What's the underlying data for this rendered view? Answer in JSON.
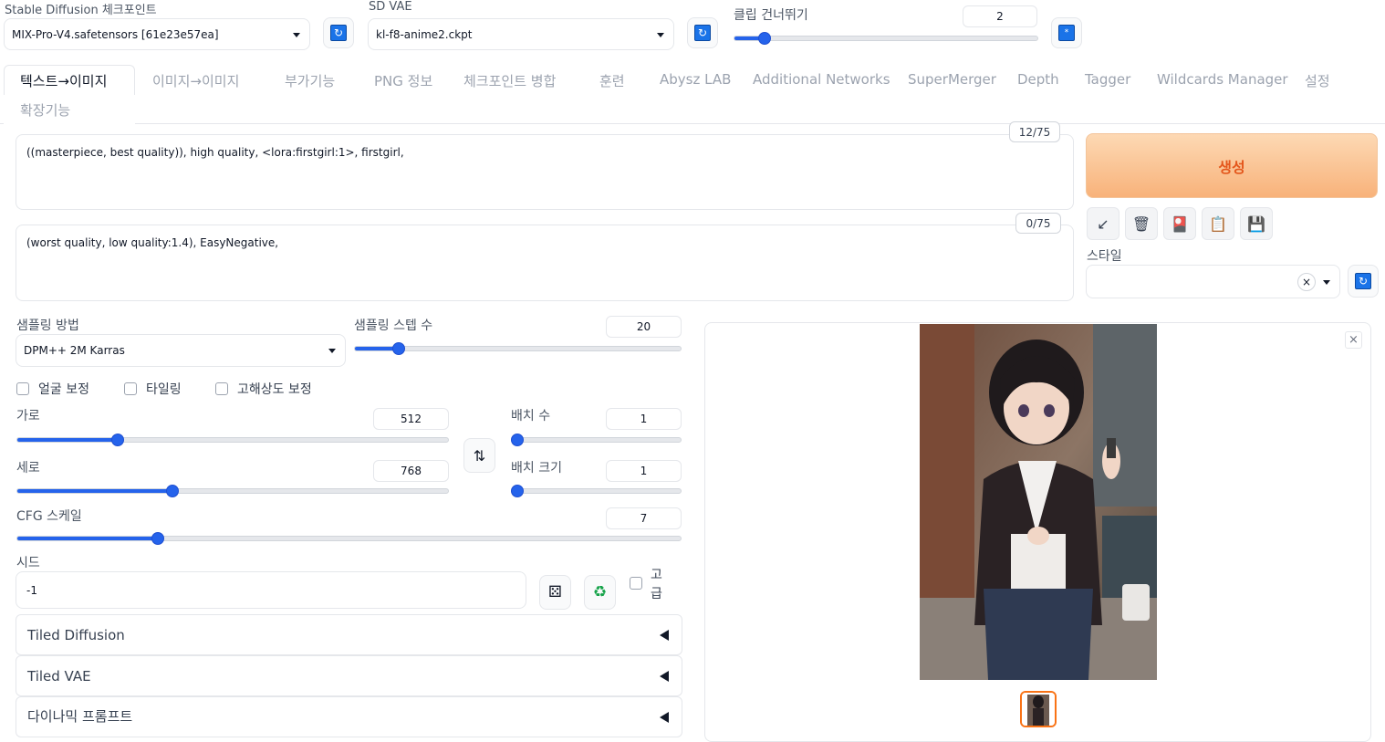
{
  "top": {
    "checkpoint": {
      "label": "Stable Diffusion 체크포인트",
      "value": "MIX-Pro-V4.safetensors [61e23e57ea]"
    },
    "vae": {
      "label": "SD VAE",
      "value": "kl-f8-anime2.ckpt"
    },
    "clip_skip": {
      "label": "클립 건너뛰기",
      "value": "2",
      "min": 1,
      "max": 12
    }
  },
  "tabs": [
    "텍스트→이미지",
    "이미지→이미지",
    "부가기능",
    "PNG 정보",
    "체크포인트 병합",
    "훈련",
    "Abysz LAB",
    "Additional Networks",
    "SuperMerger",
    "Depth",
    "Tagger",
    "Wildcards Manager",
    "설정",
    "확장기능"
  ],
  "active_tab": "텍스트→이미지",
  "prompt": {
    "text": "((masterpiece, best quality)), high quality,  <lora:firstgirl:1>, firstgirl,",
    "count": "12/75"
  },
  "negative_prompt": {
    "text": "(worst quality, low quality:1.4), EasyNegative,",
    "count": "0/75"
  },
  "generate": {
    "label": "생성"
  },
  "tools": [
    "↙",
    "🗑",
    "🎴",
    "📋",
    "💾"
  ],
  "style": {
    "label": "스타일",
    "clear": "×"
  },
  "sampling": {
    "method_label": "샘플링 방법",
    "method_value": "DPM++ 2M Karras",
    "steps_label": "샘플링 스텝 수",
    "steps_value": "20",
    "steps_fraction": 0.133
  },
  "checkboxes": [
    "얼굴 보정",
    "타일링",
    "고해상도 보정"
  ],
  "width": {
    "label": "가로",
    "value": "512",
    "fraction": 0.2
  },
  "height": {
    "label": "세로",
    "value": "768",
    "fraction": 0.33
  },
  "batch_count": {
    "label": "배치 수",
    "value": "1",
    "fraction": 0
  },
  "batch_size": {
    "label": "배치 크기",
    "value": "1",
    "fraction": 0
  },
  "swap_icon": "⇅",
  "cfg": {
    "label": "CFG 스케일",
    "value": "7",
    "fraction": 0.2
  },
  "seed": {
    "label": "시드",
    "value": "-1",
    "extra_label_1": "고",
    "extra_label_2": "급"
  },
  "accordions": [
    "Tiled Diffusion",
    "Tiled VAE",
    "다이나믹 프롬프트"
  ],
  "gallery": {
    "close": "×"
  }
}
